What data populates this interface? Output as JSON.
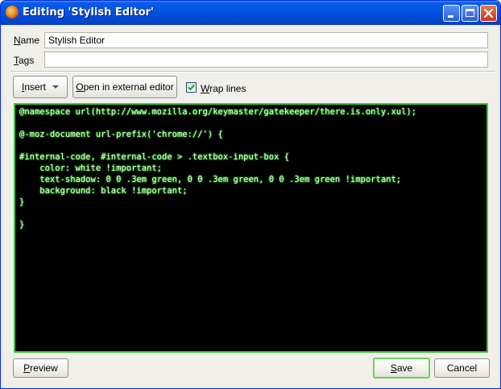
{
  "window": {
    "title": "Editing 'Stylish Editor'",
    "app_icon": "firefox-icon",
    "controls": [
      "minimize-icon",
      "maximize-icon",
      "close-icon"
    ]
  },
  "form": {
    "name_label_accel": "N",
    "name_label_rest": "ame",
    "name_value": "Stylish Editor",
    "tags_label_accel": "T",
    "tags_label_rest": "ags",
    "tags_value": ""
  },
  "toolbar": {
    "insert_label_accel": "I",
    "insert_label_rest": "nsert",
    "external_label_accel": "O",
    "external_label_rest": "pen in external editor",
    "wrap_label_accel": "W",
    "wrap_label_rest": "rap lines",
    "wrap_checked": true
  },
  "editor": {
    "code": "@namespace url(http://www.mozilla.org/keymaster/gatekeeper/there.is.only.xul);\n\n@-moz-document url-prefix('chrome://') {\n\n#internal-code, #internal-code > .textbox-input-box {\n    color: white !important;\n    text-shadow: 0 0 .3em green, 0 0 .3em green, 0 0 .3em green !important;\n    background: black !important;\n}\n\n}",
    "text_color": "#dfffd0",
    "glow_color": "#2ecc2e",
    "background_color": "#000000",
    "border_color": "#38c838"
  },
  "footer": {
    "preview_label_accel": "P",
    "preview_label_rest": "review",
    "save_label_accel": "S",
    "save_label_rest": "ave",
    "cancel_label": "Cancel"
  }
}
